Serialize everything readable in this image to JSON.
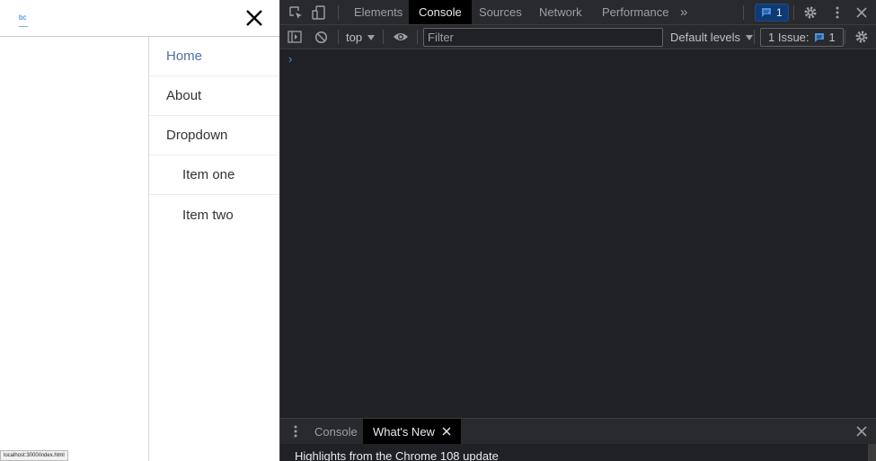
{
  "page": {
    "logo_text": "bc",
    "menu": {
      "home": "Home",
      "about": "About",
      "dropdown": "Dropdown",
      "item_one": "Item one",
      "item_two": "Item two"
    },
    "status_url": "localhost:3000/index.html"
  },
  "devtools": {
    "tabs": {
      "elements": "Elements",
      "console": "Console",
      "sources": "Sources",
      "network": "Network",
      "performance": "Performance",
      "more": "»"
    },
    "active_tab": "Console",
    "message_badge_count": "1",
    "toolbar": {
      "context": "top",
      "filter_placeholder": "Filter",
      "levels": "Default levels",
      "issues_label": "1 Issue:",
      "issues_count": "1"
    },
    "console": {
      "prompt": "›"
    },
    "drawer": {
      "tabs": {
        "console": "Console",
        "whats_new": "What's New"
      },
      "highlights": "Highlights from the Chrome 108 update"
    },
    "colors": {
      "background": "#202124",
      "toolbar": "#292a2d",
      "active_tab": "#000000",
      "accent_blue": "#1a73e8"
    },
    "icons": [
      "inspect-icon",
      "device-toggle-icon",
      "more-tabs-icon",
      "message-icon",
      "gear-icon",
      "kebab-icon",
      "close-icon",
      "sidebar-toggle-icon",
      "clear-icon",
      "eye-icon",
      "dropdown-arrow-icon"
    ]
  }
}
